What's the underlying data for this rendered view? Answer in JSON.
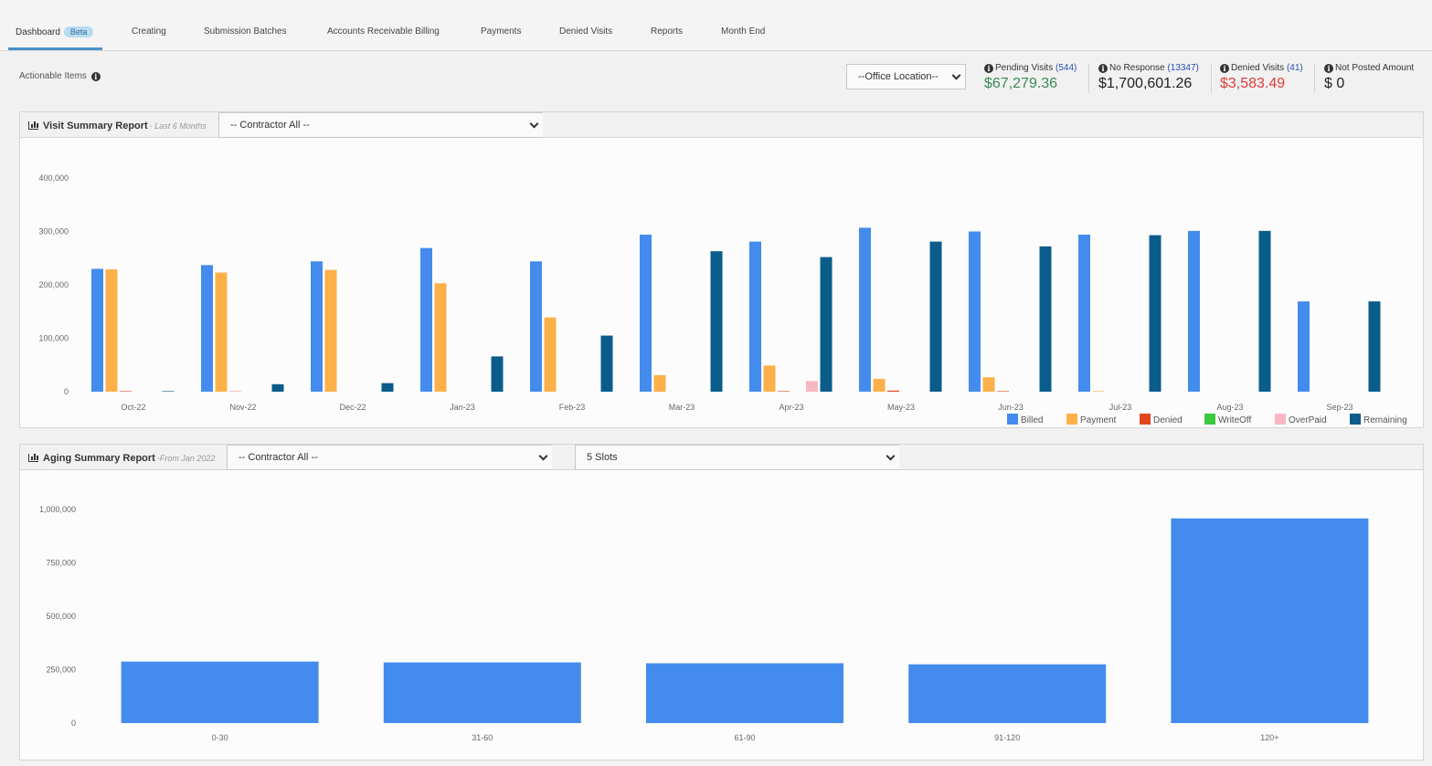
{
  "nav": {
    "tabs": [
      {
        "label": "Dashboard",
        "badge": "Beta",
        "active": true
      },
      {
        "label": "Creating"
      },
      {
        "label": "Submission Batches"
      },
      {
        "label": "Accounts Receivable Billing"
      },
      {
        "label": "Payments"
      },
      {
        "label": "Denied Visits"
      },
      {
        "label": "Reports"
      },
      {
        "label": "Month End"
      }
    ]
  },
  "actionable": {
    "label": "Actionable Items"
  },
  "office_select": {
    "value": "--Office Location--"
  },
  "stats": [
    {
      "label": "Pending Visits",
      "count": "(544)",
      "value": "$67,279.36",
      "color": "#3a8a57"
    },
    {
      "label": "No Response",
      "count": "(13347)",
      "value": "$1,700,601.26",
      "color": "#222222"
    },
    {
      "label": "Denied Visits",
      "count": "(41)",
      "value": "$3,583.49",
      "color": "#e03b3b"
    },
    {
      "label": "Not Posted Amount",
      "count": "",
      "value": "$ 0",
      "color": "#222222"
    }
  ],
  "visit_panel": {
    "title": "Visit Summary Report",
    "subtitle": "- Last 6 Months",
    "contractor_select": "-- Contractor All --"
  },
  "aging_panel": {
    "title": "Aging Summary Report",
    "subtitle": "-From Jan 2022",
    "contractor_select": "-- Contractor All --",
    "slots_select": "5 Slots"
  },
  "colors": {
    "billed": "#438cee",
    "payment": "#fdb048",
    "denied": "#e0461e",
    "writeoff": "#3ec83e",
    "overpaid": "#f9b7c3",
    "remaining": "#0a5d8a"
  },
  "chart_data": [
    {
      "type": "bar",
      "categories": [
        "Oct-22",
        "Nov-22",
        "Dec-22",
        "Jan-23",
        "Feb-23",
        "Mar-23",
        "Apr-23",
        "May-23",
        "Jun-23",
        "Jul-23",
        "Aug-23",
        "Sep-23"
      ],
      "ylim": [
        0,
        400000
      ],
      "yticks": [
        0,
        100000,
        200000,
        300000,
        400000
      ],
      "ytick_labels": [
        "0",
        "100,000",
        "200,000",
        "300,000",
        "400,000"
      ],
      "legend": "bottom-right",
      "series": [
        {
          "name": "Billed",
          "color_key": "billed",
          "values": [
            230000,
            237000,
            244000,
            269000,
            244000,
            294000,
            281000,
            307000,
            300000,
            294000,
            301000,
            169000
          ]
        },
        {
          "name": "Payment",
          "color_key": "payment",
          "values": [
            229000,
            223000,
            228000,
            203000,
            139000,
            31000,
            49000,
            24000,
            27000,
            1000,
            0,
            0
          ]
        },
        {
          "name": "Denied",
          "color_key": "denied",
          "values": [
            1000,
            500,
            0,
            0,
            0,
            0,
            1000,
            2000,
            1000,
            0,
            0,
            0
          ]
        },
        {
          "name": "WriteOff",
          "color_key": "writeoff",
          "values": [
            0,
            0,
            0,
            0,
            0,
            0,
            0,
            0,
            0,
            0,
            0,
            0
          ]
        },
        {
          "name": "OverPaid",
          "color_key": "overpaid",
          "values": [
            0,
            0,
            0,
            0,
            0,
            0,
            20000,
            0,
            0,
            0,
            0,
            0
          ]
        },
        {
          "name": "Remaining",
          "color_key": "remaining",
          "values": [
            1000,
            14000,
            16000,
            66000,
            105000,
            263000,
            252000,
            281000,
            272000,
            293000,
            301000,
            169000
          ]
        }
      ]
    },
    {
      "type": "bar",
      "categories": [
        "0-30",
        "31-60",
        "61-90",
        "91-120",
        "120+"
      ],
      "ylim": [
        0,
        1000000
      ],
      "yticks": [
        0,
        250000,
        500000,
        750000,
        1000000
      ],
      "ytick_labels": [
        "0",
        "250,000",
        "500,000",
        "750,000",
        "1,000,000"
      ],
      "values": [
        288000,
        284000,
        280000,
        275000,
        958000
      ],
      "color_key": "billed"
    }
  ]
}
